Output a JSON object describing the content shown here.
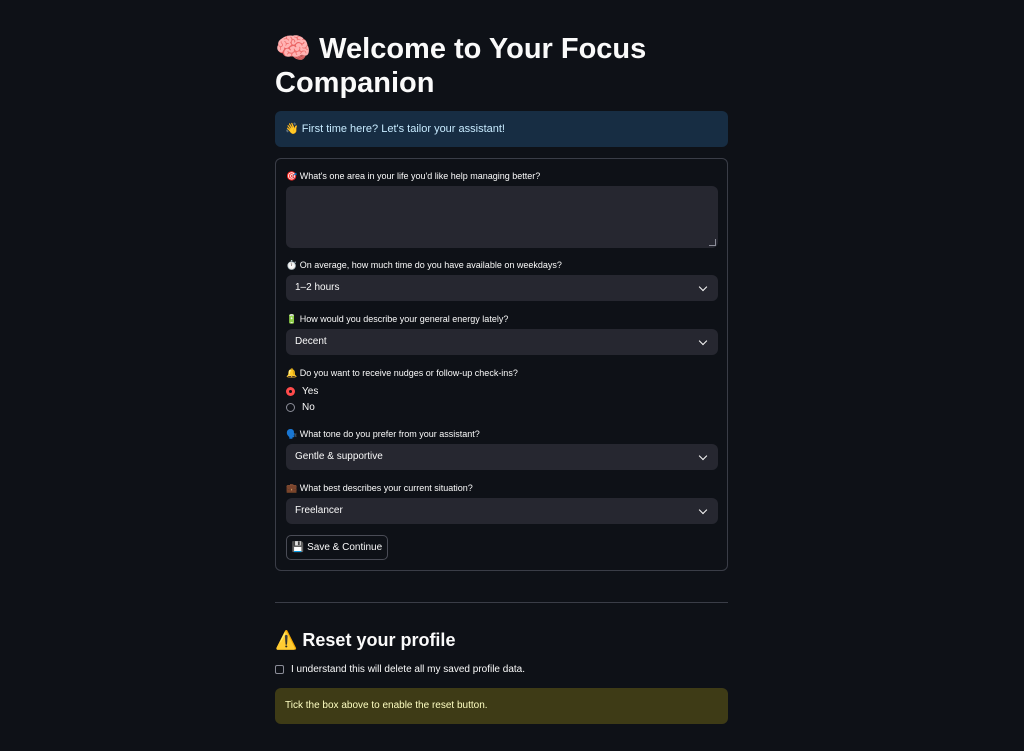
{
  "header": {
    "title": "🧠 Welcome to Your Focus Companion"
  },
  "info_banner": {
    "text": "👋 First time here? Let's tailor your assistant!"
  },
  "form": {
    "q_area": {
      "label": "🎯 What's one area in your life you'd like help managing better?",
      "value": ""
    },
    "q_time": {
      "label": "⏱️ On average, how much time do you have available on weekdays?",
      "selected": "1–2 hours"
    },
    "q_energy": {
      "label": "🔋 How would you describe your general energy lately?",
      "selected": "Decent"
    },
    "q_nudges": {
      "label": "🔔 Do you want to receive nudges or follow-up check-ins?",
      "options": [
        "Yes",
        "No"
      ],
      "selected": "Yes"
    },
    "q_tone": {
      "label": "🗣️ What tone do you prefer from your assistant?",
      "selected": "Gentle & supportive"
    },
    "q_situation": {
      "label": "💼 What best describes your current situation?",
      "selected": "Freelancer"
    },
    "submit_label": "💾 Save & Continue"
  },
  "reset": {
    "heading": "⚠️ Reset your profile",
    "checkbox_label": "I understand this will delete all my saved profile data.",
    "checked": false,
    "warning_text": "Tick the box above to enable the reset button."
  },
  "colors": {
    "background": "#0e1117",
    "input_bg": "#262730",
    "info_bg": "#172d43",
    "info_text": "#c7ebff",
    "warning_bg": "#3e3b16",
    "warning_text": "#ffffc2",
    "accent": "#ff4b4b"
  }
}
